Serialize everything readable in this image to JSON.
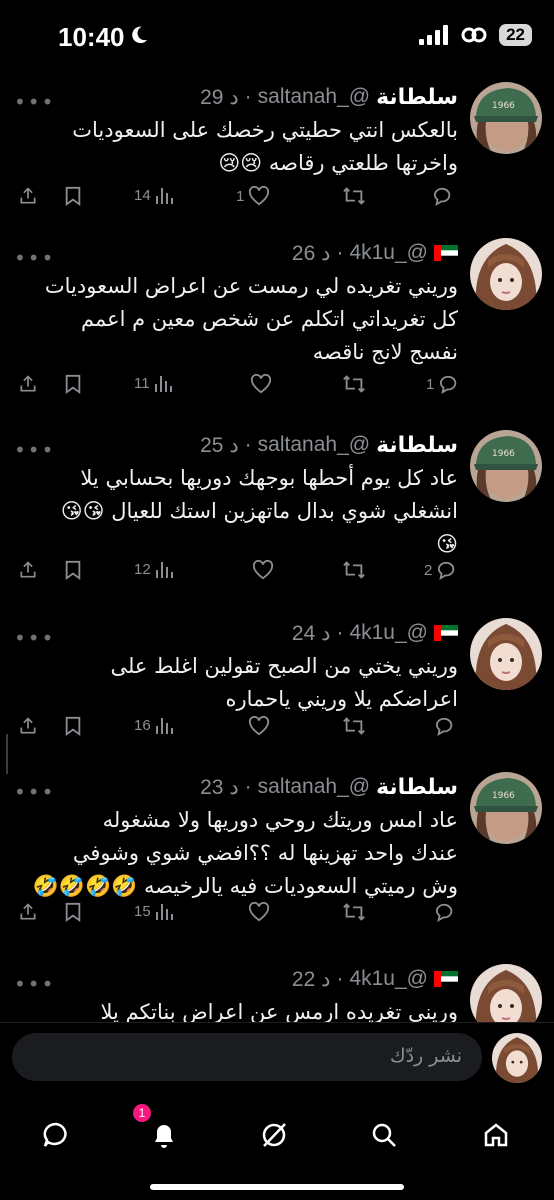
{
  "status_bar": {
    "time": "10:40",
    "battery": "22",
    "icons": [
      "moon-icon",
      "signal-icon",
      "link-icon",
      "battery-icon"
    ]
  },
  "tweets": [
    {
      "display_name": "سلطانة",
      "handle": "saltanah_@",
      "time": "29 د",
      "has_flag": false,
      "avatar": "green-cap",
      "text_lines": [
        "بالعكس انتي حطيتي رخصك على السعوديات",
        "واخرتها طلعتي رقاصه 😢😢"
      ],
      "views": "14",
      "likes": "1",
      "retweets": "",
      "replies": ""
    },
    {
      "display_name": "",
      "handle": "4k1u_@",
      "time": "26 د",
      "has_flag": true,
      "avatar": "bangs-girl",
      "text_lines": [
        "وريني تغريده لي رمست عن اعراض السعوديات",
        "كل تغريداتي اتكلم عن شخص معين م اعمم",
        "نفسج لانج ناقصه"
      ],
      "views": "11",
      "likes": "",
      "retweets": "",
      "replies": "1"
    },
    {
      "display_name": "سلطانة",
      "handle": "saltanah_@",
      "time": "25 د",
      "has_flag": false,
      "avatar": "green-cap",
      "text_lines": [
        "عاد كل يوم أحطها بوجهك دوريها بحسابي يلا",
        "انشغلي شوي بدال ماتهزين استك للعيال 😘😘",
        "😘"
      ],
      "views": "12",
      "likes": "",
      "retweets": "",
      "replies": "2"
    },
    {
      "display_name": "",
      "handle": "4k1u_@",
      "time": "24 د",
      "has_flag": true,
      "avatar": "bangs-girl",
      "text_lines": [
        "وريني يختي من الصبح تقولين اغلط على",
        "اعراضكم يلا وريني ياحماره"
      ],
      "views": "16",
      "likes": "",
      "retweets": "",
      "replies": ""
    },
    {
      "display_name": "سلطانة",
      "handle": "saltanah_@",
      "time": "23 د",
      "has_flag": false,
      "avatar": "green-cap",
      "text_lines": [
        "عاد امس وريتك روحي دوريها ولا مشغوله",
        "عندك واحد تهزينها له ؟؟افضي شوي وشوفي",
        "وش رميتي السعوديات فيه يالرخيصه 🤣🤣🤣🤣"
      ],
      "views": "15",
      "likes": "",
      "retweets": "",
      "replies": ""
    },
    {
      "display_name": "",
      "handle": "4k1u_@",
      "time": "22 د",
      "has_flag": true,
      "avatar": "bangs-girl",
      "text_lines": [
        "وريني تغريده ارمس عن اعراض بناتكم يلا"
      ],
      "views": "",
      "likes": "",
      "retweets": "",
      "replies": ""
    }
  ],
  "reply_bar": {
    "placeholder": "نشر ردّك"
  },
  "bottom_nav": {
    "items": [
      "messages-icon",
      "notifications-icon",
      "grok-icon",
      "search-icon",
      "home-icon"
    ],
    "notification_badge": "1"
  },
  "colors": {
    "background": "#000000",
    "text": "#e7e9ea",
    "muted": "#8b8f94",
    "badge": "#f91880",
    "cap_green": "#3f6b4e"
  }
}
